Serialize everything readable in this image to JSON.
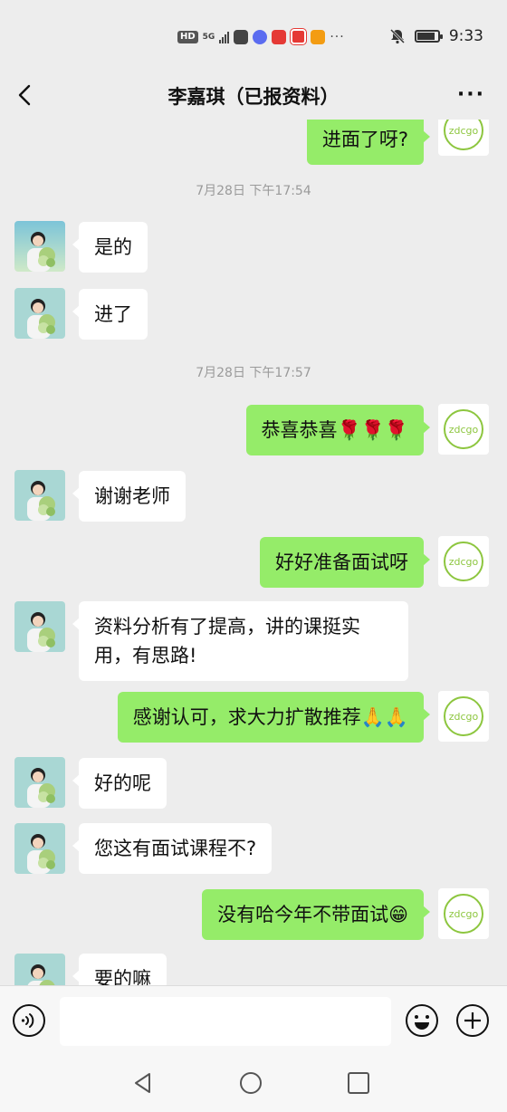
{
  "status_bar": {
    "time": "9:33",
    "hd": "HD",
    "network": "5G",
    "battery_level": 0.85,
    "more_indicator": "···"
  },
  "header": {
    "title": "李嘉琪（已报资料）",
    "back_icon": "chevron-left-icon",
    "more_icon": "more-dots-icon"
  },
  "chat": {
    "timestamps": [
      "7月28日 下午17:54",
      "7月28日 下午17:57"
    ],
    "messages": [
      {
        "from": "me",
        "text": "进面了呀?"
      },
      {
        "from": "them",
        "text": "是的"
      },
      {
        "from": "them",
        "text": "进了"
      },
      {
        "from": "me",
        "text": "恭喜恭喜🌹🌹🌹"
      },
      {
        "from": "them",
        "text": "谢谢老师"
      },
      {
        "from": "me",
        "text": "好好准备面试呀"
      },
      {
        "from": "them",
        "text": "资料分析有了提高，讲的课挺实用，有思路!"
      },
      {
        "from": "me",
        "text": "感谢认可，求大力扩散推荐🙏🙏"
      },
      {
        "from": "them",
        "text": "好的呢"
      },
      {
        "from": "them",
        "text": "您这有面试课程不?"
      },
      {
        "from": "me",
        "text": "没有哈今年不带面试😁"
      },
      {
        "from": "them",
        "text": "要的嘛"
      }
    ],
    "my_avatar_logo": "zdcgo"
  },
  "input_bar": {
    "voice_icon": "voice-icon",
    "emoji_icon": "emoji-icon",
    "plus_icon": "plus-icon",
    "input_value": ""
  },
  "colors": {
    "background": "#ededed",
    "my_bubble": "#95ec69",
    "their_bubble": "#ffffff",
    "logo_green": "#8dc63f"
  }
}
